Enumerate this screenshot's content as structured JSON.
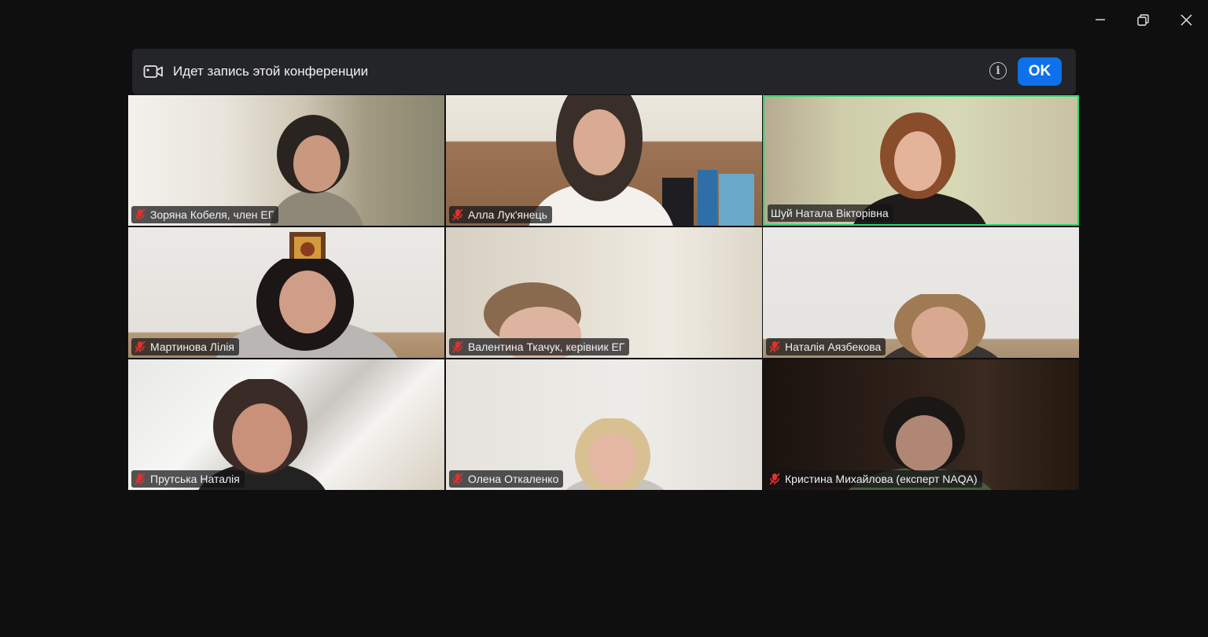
{
  "window_controls": {
    "minimize_icon": "minimize-icon",
    "restore_icon": "restore-icon",
    "close_icon": "close-icon"
  },
  "banner": {
    "text": "Идет запись этой конференции",
    "ok_label": "OK",
    "info_label": "i"
  },
  "participants": [
    {
      "name": "Зоряна Кобеля, член ЕГ",
      "muted": true
    },
    {
      "name": "Алла Лук'янець",
      "muted": true
    },
    {
      "name": "Шуй Натала Вікторівна",
      "muted": false,
      "active_speaker": true
    },
    {
      "name": "Мартинова Лілія",
      "muted": true
    },
    {
      "name": "Валентина Ткачук, керівник ЕГ",
      "muted": true
    },
    {
      "name": "Наталія Аязбекова",
      "muted": true
    },
    {
      "name": "Прутська Наталія",
      "muted": true
    },
    {
      "name": "Олена Откаленко",
      "muted": true
    },
    {
      "name": "Кристина Михайлова (експерт NAQA)",
      "muted": true
    }
  ],
  "colors": {
    "background": "#0f0f10",
    "banner": "#242529",
    "ok_button": "#0e71eb",
    "active_border": "#2bd66d",
    "muted_icon": "#e0312b"
  }
}
